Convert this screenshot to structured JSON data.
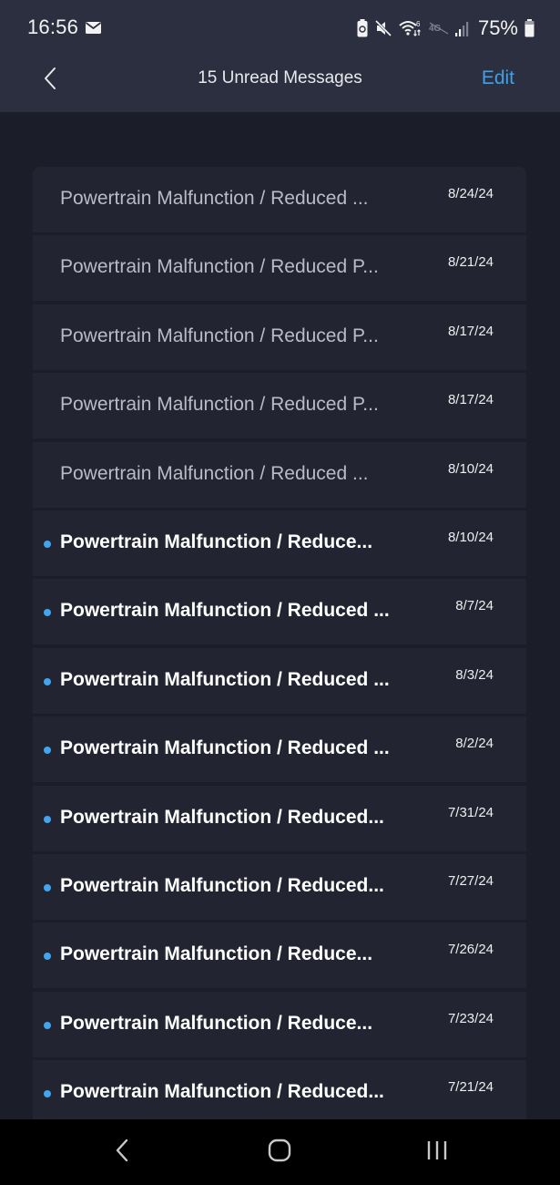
{
  "status_bar": {
    "time": "16:56",
    "notification_icon": "mail-icon",
    "right_icons": [
      "battery-saver-icon",
      "mute-icon",
      "wifi-6-icon",
      "4g-disabled-icon",
      "signal-icon"
    ],
    "battery_percent": "75%"
  },
  "header": {
    "back_icon": "chevron-left-icon",
    "title": "15 Unread Messages",
    "edit_label": "Edit"
  },
  "colors": {
    "accent": "#3fa1e8",
    "unread_dot": "#41a5f0",
    "header_bg": "#2c2f3f",
    "page_bg": "#1b1d28",
    "row_bg": "#222431"
  },
  "messages": [
    {
      "subject": "Powertrain Malfunction / Reduced ...",
      "date": "8/24/24",
      "unread": false
    },
    {
      "subject": "Powertrain Malfunction / Reduced P...",
      "date": "8/21/24",
      "unread": false
    },
    {
      "subject": "Powertrain Malfunction / Reduced P...",
      "date": "8/17/24",
      "unread": false
    },
    {
      "subject": "Powertrain Malfunction / Reduced P...",
      "date": "8/17/24",
      "unread": false
    },
    {
      "subject": "Powertrain Malfunction / Reduced ...",
      "date": "8/10/24",
      "unread": false
    },
    {
      "subject": "Powertrain Malfunction / Reduce...",
      "date": "8/10/24",
      "unread": true
    },
    {
      "subject": "Powertrain Malfunction / Reduced ...",
      "date": "8/7/24",
      "unread": true
    },
    {
      "subject": "Powertrain Malfunction / Reduced ...",
      "date": "8/3/24",
      "unread": true
    },
    {
      "subject": "Powertrain Malfunction / Reduced ...",
      "date": "8/2/24",
      "unread": true
    },
    {
      "subject": "Powertrain Malfunction / Reduced...",
      "date": "7/31/24",
      "unread": true
    },
    {
      "subject": "Powertrain Malfunction / Reduced...",
      "date": "7/27/24",
      "unread": true
    },
    {
      "subject": "Powertrain Malfunction / Reduce...",
      "date": "7/26/24",
      "unread": true
    },
    {
      "subject": "Powertrain Malfunction / Reduce...",
      "date": "7/23/24",
      "unread": true
    },
    {
      "subject": "Powertrain Malfunction / Reduced...",
      "date": "7/21/24",
      "unread": true
    }
  ],
  "nav_bar": {
    "buttons": [
      "back-icon",
      "home-icon",
      "recents-icon"
    ]
  }
}
